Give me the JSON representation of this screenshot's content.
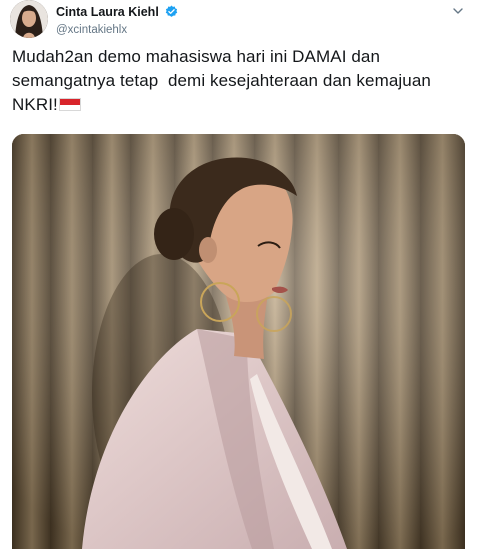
{
  "tweet": {
    "display_name": "Cinta Laura Kiehl",
    "handle": "@xcintakiehlx",
    "text": "Mudah2an demo mahasiswa hari ini DAMAI dan semangatnya tetap  demi kesejahteraan dan kemajuan NKRI!",
    "emoji": "indonesia-flag-emoji"
  },
  "icons": {
    "verified": "verified-badge-icon",
    "caret": "chevron-down-icon"
  },
  "colors": {
    "verified_blue": "#1da1f2",
    "handle_gray": "#657786",
    "text": "#14171a",
    "flag_red": "#d8242b"
  }
}
